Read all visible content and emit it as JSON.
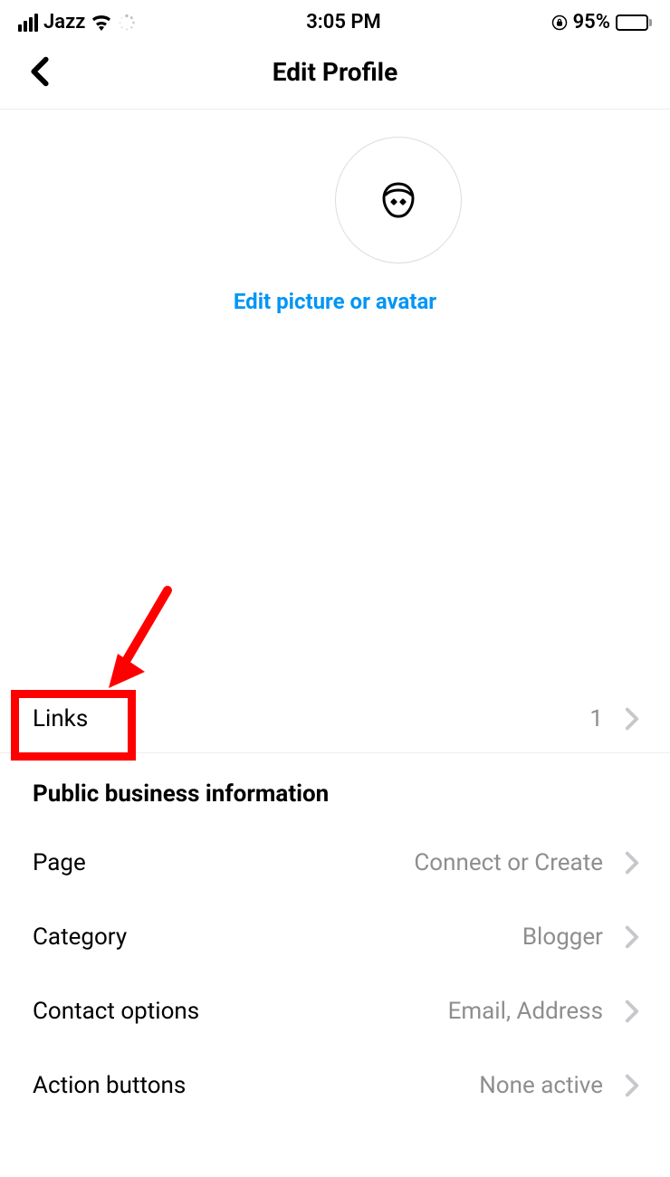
{
  "statusBar": {
    "carrier": "Jazz",
    "time": "3:05 PM",
    "battery": "95%"
  },
  "header": {
    "title": "Edit Profile"
  },
  "avatar": {
    "editLink": "Edit picture or avatar"
  },
  "links": {
    "label": "Links",
    "value": "1"
  },
  "businessSection": {
    "title": "Public business information",
    "rows": [
      {
        "label": "Page",
        "value": "Connect or Create"
      },
      {
        "label": "Category",
        "value": "Blogger"
      },
      {
        "label": "Contact options",
        "value": "Email, Address"
      },
      {
        "label": "Action buttons",
        "value": "None active"
      }
    ]
  }
}
